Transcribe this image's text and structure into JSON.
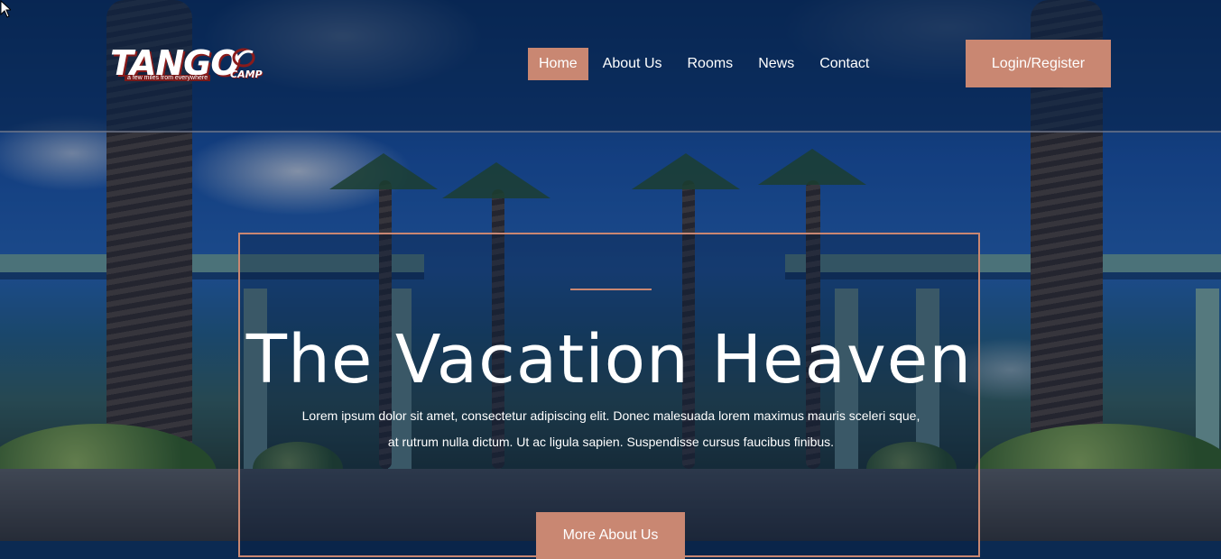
{
  "brand": {
    "name": "TANGO",
    "tagline": "a few miles from everywhere",
    "suffix": "CAMP",
    "accent_color": "#c98772",
    "logo_red": "#8a1b1b"
  },
  "nav": {
    "items": [
      {
        "label": "Home",
        "active": true
      },
      {
        "label": "About Us",
        "active": false
      },
      {
        "label": "Rooms",
        "active": false
      },
      {
        "label": "News",
        "active": false
      },
      {
        "label": "Contact",
        "active": false
      }
    ]
  },
  "header": {
    "login_label": "Login/Register"
  },
  "hero": {
    "title": "The Vacation Heaven",
    "body": "Lorem ipsum dolor sit amet, consectetur adipiscing elit. Donec malesuada lorem maximus mauris sceleri sque, at rutrum nulla dictum. Ut ac ligula sapien. Suspendisse cursus faucibus finibus.",
    "button_label": "More About Us"
  }
}
